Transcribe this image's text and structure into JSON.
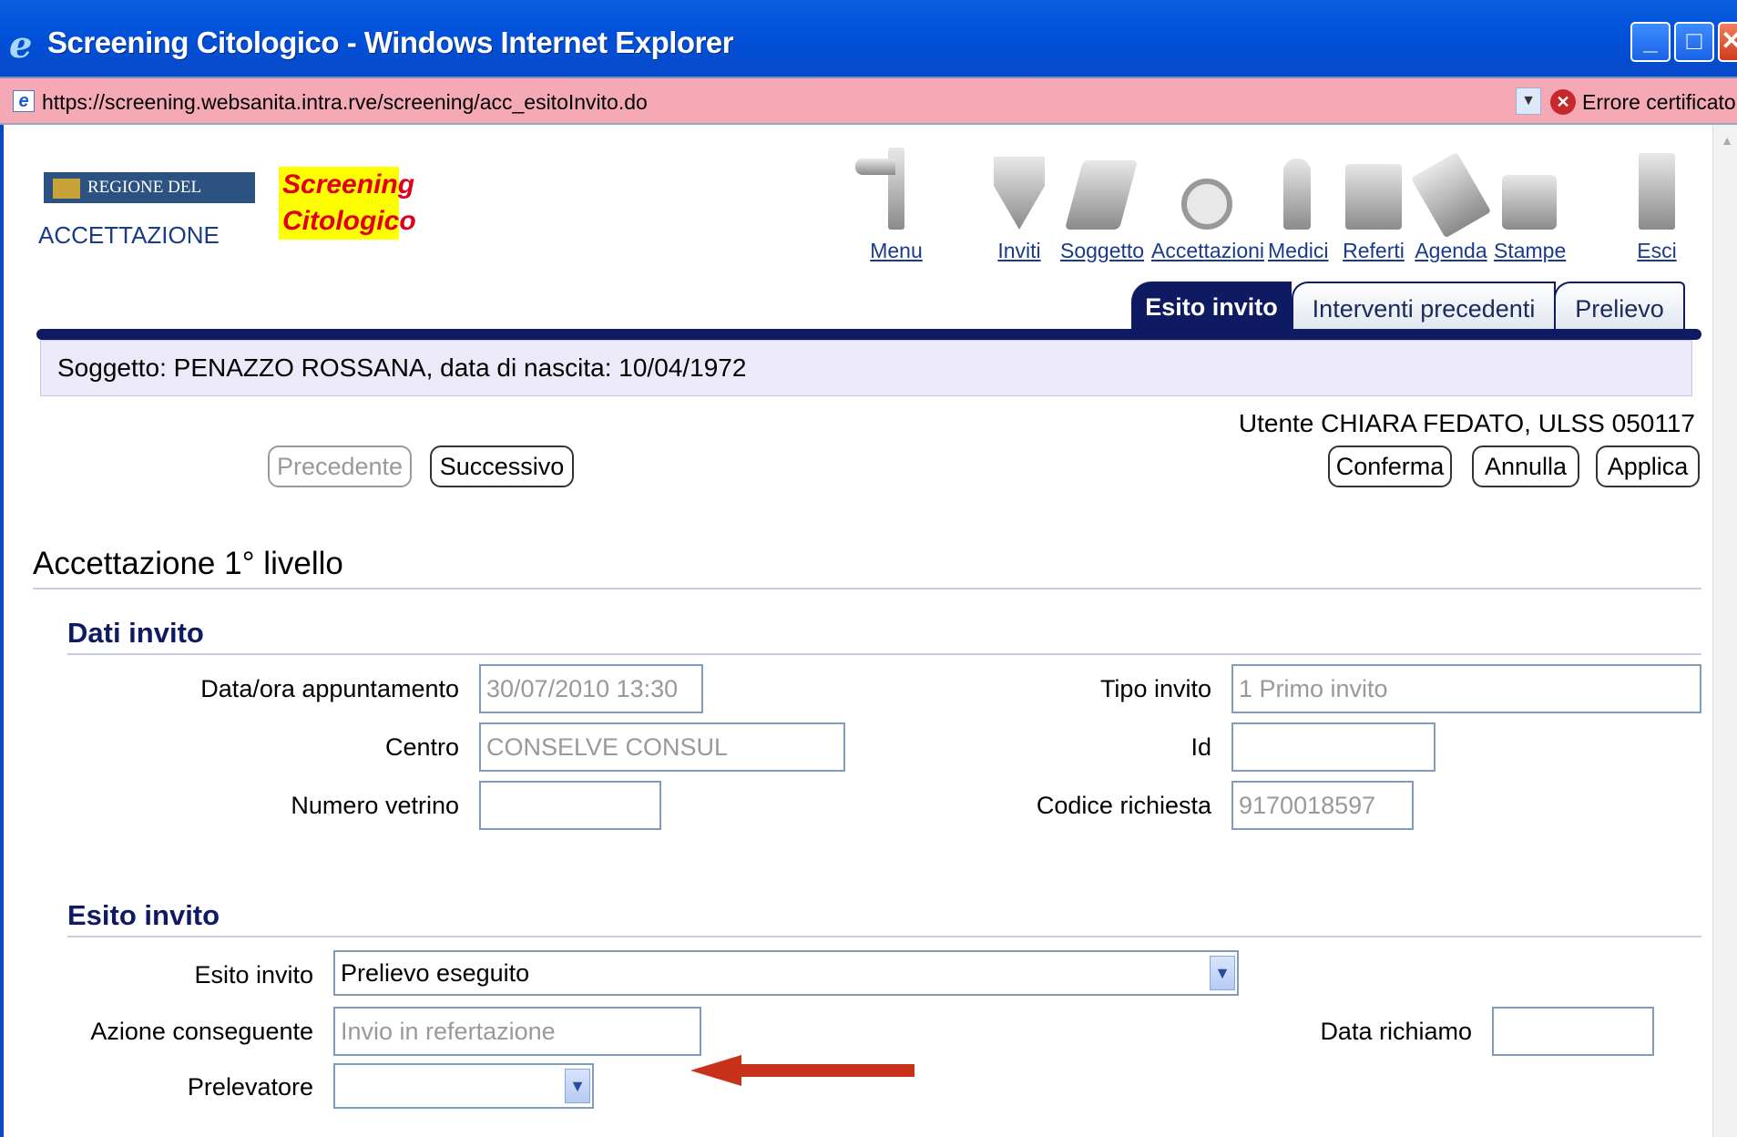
{
  "window": {
    "title": "Screening Citologico - Windows Internet Explorer",
    "url": "https://screening.websanita.intra.rve/screening/acc_esitoInvito.do",
    "cert_error": "Errore certificato"
  },
  "header": {
    "logo_text": "REGIONE DEL VENETO",
    "area": "ACCETTAZIONE",
    "app_name_line1": "Screening",
    "app_name_line2": "Citologico"
  },
  "toolbar": {
    "items": [
      {
        "label": "Menu",
        "icon": "signpost-icon"
      },
      {
        "label": "Inviti",
        "icon": "envelope-icon"
      },
      {
        "label": "Soggetto",
        "icon": "keyboard-icon"
      },
      {
        "label": "Accettazioni",
        "icon": "magnifier-icon"
      },
      {
        "label": "Medici",
        "icon": "doctor-icon"
      },
      {
        "label": "Referti",
        "icon": "fax-icon"
      },
      {
        "label": "Agenda",
        "icon": "calendar-icon"
      },
      {
        "label": "Stampe",
        "icon": "printer-icon"
      },
      {
        "label": "Esci",
        "icon": "exit-door-icon"
      }
    ]
  },
  "tabs": [
    {
      "label": "Esito invito",
      "active": true
    },
    {
      "label": "Interventi precedenti",
      "active": false
    },
    {
      "label": "Prelievo",
      "active": false
    }
  ],
  "subject": "Soggetto: PENAZZO ROSSANA, data di nascita: 10/04/1972",
  "user_info": "Utente CHIARA FEDATO, ULSS 050117",
  "buttons": {
    "precedente": "Precedente",
    "successivo": "Successivo",
    "conferma": "Conferma",
    "annulla": "Annulla",
    "applica": "Applica"
  },
  "section_title": "Accettazione 1° livello",
  "dati_invito": {
    "title": "Dati invito",
    "data_ora_label": "Data/ora appuntamento",
    "data_ora_value": "30/07/2010 13:30",
    "centro_label": "Centro",
    "centro_value": "CONSELVE CONSUL",
    "numero_vetrino_label": "Numero vetrino",
    "numero_vetrino_value": "",
    "tipo_invito_label": "Tipo invito",
    "tipo_invito_value": "1  Primo invito",
    "id_label": "Id",
    "id_value": "",
    "codice_richiesta_label": "Codice richiesta",
    "codice_richiesta_value": "9170018597"
  },
  "esito_invito": {
    "title": "Esito invito",
    "esito_label": "Esito invito",
    "esito_value": "Prelievo eseguito",
    "azione_label": "Azione conseguente",
    "azione_value": "Invio in refertazione",
    "prelevatore_label": "Prelevatore",
    "prelevatore_value": "",
    "data_richiamo_label": "Data richiamo",
    "data_richiamo_value": ""
  },
  "colors": {
    "titlebar": "#0050d8",
    "address_bar": "#f4a9b4",
    "nav_dark": "#0e1a62",
    "annotation_arrow": "#c8321a"
  }
}
